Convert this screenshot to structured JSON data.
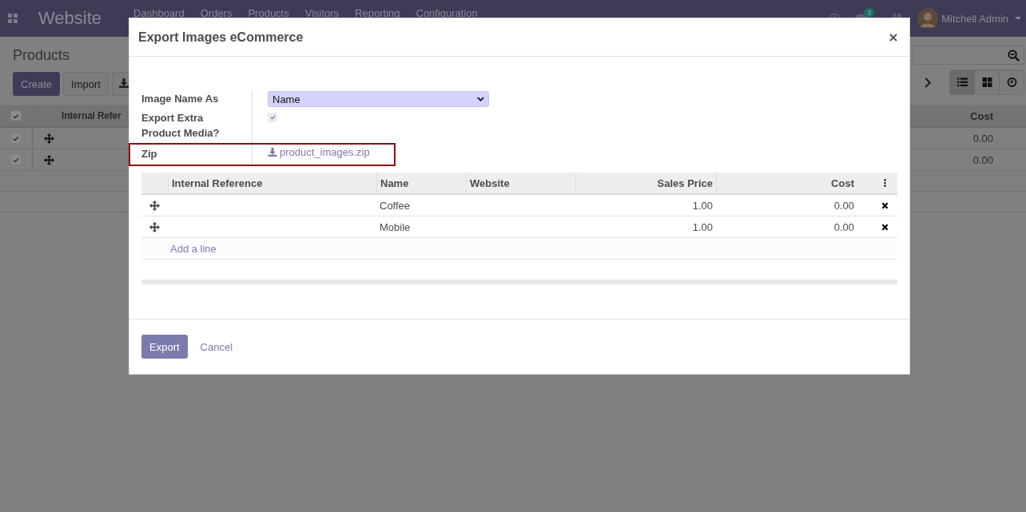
{
  "navbar": {
    "app_name": "Website",
    "menu": [
      "Dashboard",
      "Orders",
      "Products",
      "Visitors",
      "Reporting",
      "Configuration"
    ],
    "messages_count": "3",
    "user": "Mitchell Admin"
  },
  "control_panel": {
    "title": "Products",
    "buttons": [
      "Create",
      "Import"
    ],
    "views": [
      {
        "kind": "list",
        "selected": true
      },
      {
        "kind": "kanban",
        "selected": false
      },
      {
        "kind": "activity",
        "selected": false
      }
    ]
  },
  "list": {
    "header_checked": true,
    "columns": [
      "Internal Refer",
      "Cost"
    ],
    "rows": [
      {
        "checked": true,
        "cost": "0.00"
      },
      {
        "checked": true,
        "cost": "0.00"
      }
    ]
  },
  "dialog": {
    "title": "Export Images eCommerce",
    "fields": [
      {
        "kind": "select",
        "label": "Image Name As",
        "value": "Name",
        "highlighted": false
      },
      {
        "kind": "checkbox",
        "label": "Export Extra Product Media?",
        "checked": true,
        "highlighted": false
      },
      {
        "kind": "link",
        "label": "Zip",
        "value": "product_images.zip",
        "highlighted": true
      }
    ],
    "table": {
      "columns": [
        "Internal Reference",
        "Name",
        "Website",
        "Sales Price",
        "Cost"
      ],
      "rows": [
        {
          "internal_reference": "",
          "name": "Coffee",
          "website": "",
          "sales_price": "1.00",
          "cost": "0.00"
        },
        {
          "internal_reference": "",
          "name": "Mobile",
          "website": "",
          "sales_price": "1.00",
          "cost": "0.00"
        }
      ],
      "add_line": "Add a line"
    },
    "buttons": [
      {
        "kind": "primary",
        "label": "Export"
      },
      {
        "kind": "link",
        "label": "Cancel"
      }
    ]
  }
}
